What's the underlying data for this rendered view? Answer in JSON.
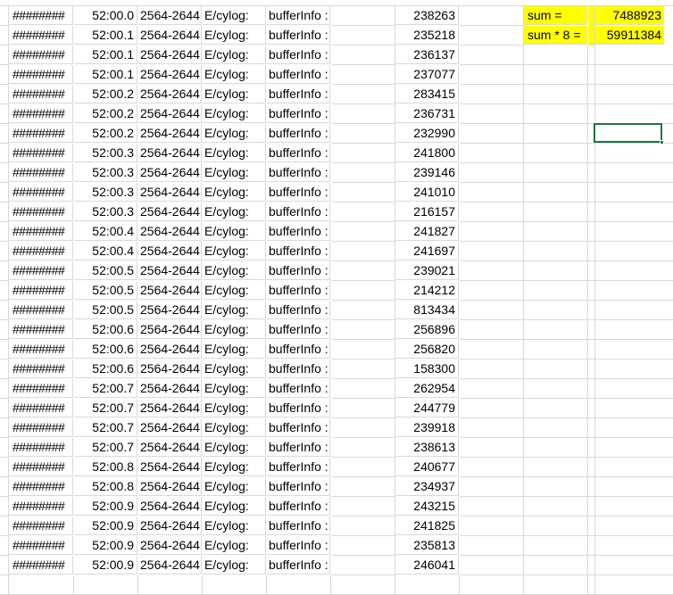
{
  "sheet": {
    "rows": [
      {
        "date": "########",
        "time": "52:00.0",
        "pid": "2564-2644",
        "tag": "E/cylog:",
        "label": "bufferInfo :",
        "value": "238263"
      },
      {
        "date": "########",
        "time": "52:00.1",
        "pid": "2564-2644",
        "tag": "E/cylog:",
        "label": "bufferInfo :",
        "value": "235218"
      },
      {
        "date": "########",
        "time": "52:00.1",
        "pid": "2564-2644",
        "tag": "E/cylog:",
        "label": "bufferInfo :",
        "value": "236137"
      },
      {
        "date": "########",
        "time": "52:00.1",
        "pid": "2564-2644",
        "tag": "E/cylog:",
        "label": "bufferInfo :",
        "value": "237077"
      },
      {
        "date": "########",
        "time": "52:00.2",
        "pid": "2564-2644",
        "tag": "E/cylog:",
        "label": "bufferInfo :",
        "value": "283415"
      },
      {
        "date": "########",
        "time": "52:00.2",
        "pid": "2564-2644",
        "tag": "E/cylog:",
        "label": "bufferInfo :",
        "value": "236731"
      },
      {
        "date": "########",
        "time": "52:00.2",
        "pid": "2564-2644",
        "tag": "E/cylog:",
        "label": "bufferInfo :",
        "value": "232990"
      },
      {
        "date": "########",
        "time": "52:00.3",
        "pid": "2564-2644",
        "tag": "E/cylog:",
        "label": "bufferInfo :",
        "value": "241800"
      },
      {
        "date": "########",
        "time": "52:00.3",
        "pid": "2564-2644",
        "tag": "E/cylog:",
        "label": "bufferInfo :",
        "value": "239146"
      },
      {
        "date": "########",
        "time": "52:00.3",
        "pid": "2564-2644",
        "tag": "E/cylog:",
        "label": "bufferInfo :",
        "value": "241010"
      },
      {
        "date": "########",
        "time": "52:00.3",
        "pid": "2564-2644",
        "tag": "E/cylog:",
        "label": "bufferInfo :",
        "value": "216157"
      },
      {
        "date": "########",
        "time": "52:00.4",
        "pid": "2564-2644",
        "tag": "E/cylog:",
        "label": "bufferInfo :",
        "value": "241827"
      },
      {
        "date": "########",
        "time": "52:00.4",
        "pid": "2564-2644",
        "tag": "E/cylog:",
        "label": "bufferInfo :",
        "value": "241697"
      },
      {
        "date": "########",
        "time": "52:00.5",
        "pid": "2564-2644",
        "tag": "E/cylog:",
        "label": "bufferInfo :",
        "value": "239021"
      },
      {
        "date": "########",
        "time": "52:00.5",
        "pid": "2564-2644",
        "tag": "E/cylog:",
        "label": "bufferInfo :",
        "value": "214212"
      },
      {
        "date": "########",
        "time": "52:00.5",
        "pid": "2564-2644",
        "tag": "E/cylog:",
        "label": "bufferInfo :",
        "value": "813434"
      },
      {
        "date": "########",
        "time": "52:00.6",
        "pid": "2564-2644",
        "tag": "E/cylog:",
        "label": "bufferInfo :",
        "value": "256896"
      },
      {
        "date": "########",
        "time": "52:00.6",
        "pid": "2564-2644",
        "tag": "E/cylog:",
        "label": "bufferInfo :",
        "value": "256820"
      },
      {
        "date": "########",
        "time": "52:00.6",
        "pid": "2564-2644",
        "tag": "E/cylog:",
        "label": "bufferInfo :",
        "value": "158300"
      },
      {
        "date": "########",
        "time": "52:00.7",
        "pid": "2564-2644",
        "tag": "E/cylog:",
        "label": "bufferInfo :",
        "value": "262954"
      },
      {
        "date": "########",
        "time": "52:00.7",
        "pid": "2564-2644",
        "tag": "E/cylog:",
        "label": "bufferInfo :",
        "value": "244779"
      },
      {
        "date": "########",
        "time": "52:00.7",
        "pid": "2564-2644",
        "tag": "E/cylog:",
        "label": "bufferInfo :",
        "value": "239918"
      },
      {
        "date": "########",
        "time": "52:00.7",
        "pid": "2564-2644",
        "tag": "E/cylog:",
        "label": "bufferInfo :",
        "value": "238613"
      },
      {
        "date": "########",
        "time": "52:00.8",
        "pid": "2564-2644",
        "tag": "E/cylog:",
        "label": "bufferInfo :",
        "value": "240677"
      },
      {
        "date": "########",
        "time": "52:00.8",
        "pid": "2564-2644",
        "tag": "E/cylog:",
        "label": "bufferInfo :",
        "value": "234937"
      },
      {
        "date": "########",
        "time": "52:00.9",
        "pid": "2564-2644",
        "tag": "E/cylog:",
        "label": "bufferInfo :",
        "value": "243215"
      },
      {
        "date": "########",
        "time": "52:00.9",
        "pid": "2564-2644",
        "tag": "E/cylog:",
        "label": "bufferInfo :",
        "value": "241825"
      },
      {
        "date": "########",
        "time": "52:00.9",
        "pid": "2564-2644",
        "tag": "E/cylog:",
        "label": "bufferInfo :",
        "value": "235813"
      },
      {
        "date": "########",
        "time": "52:00.9",
        "pid": "2564-2644",
        "tag": "E/cylog:",
        "label": "bufferInfo :",
        "value": "246041"
      }
    ],
    "summary": {
      "sum_label": "sum =",
      "sum_value": "7488923",
      "sum8_label": "sum * 8 =",
      "sum8_value": "59911384"
    },
    "colors": {
      "highlight": "#ffff00",
      "gridline": "#d9d9d9",
      "selection": "#217346"
    }
  }
}
